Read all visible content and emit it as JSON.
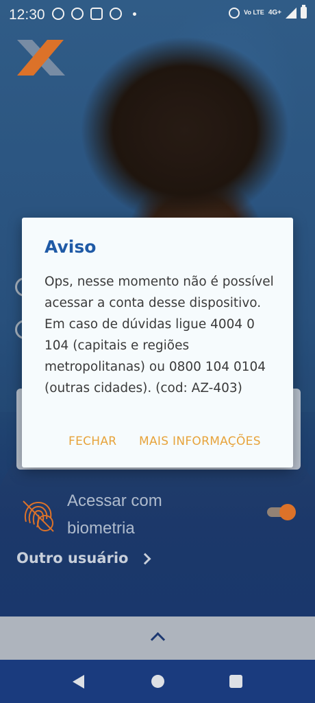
{
  "status_bar": {
    "time": "12:30",
    "network": "4G+",
    "volte": "Vo LTE",
    "icons_left": [
      "chat-bubble-icon",
      "whatsapp-icon",
      "instagram-icon",
      "avatar-icon"
    ],
    "icons_right": [
      "alarm-icon",
      "volte-icon",
      "signal-icon",
      "battery-icon"
    ]
  },
  "dialog": {
    "title": "Aviso",
    "message": "Ops, nesse momento não é possível acessar a conta desse dispositivo. Em caso de dúvidas ligue 4004 0 104 (capitais e regiões metropolitanas) ou 0800 104 0104 (outras cidades). (cod: AZ-403)",
    "close_label": "FECHAR",
    "more_info_label": "MAIS INFORMAÇÕES"
  },
  "login": {
    "biometry_label": "Acessar com biometria",
    "biometry_enabled": true,
    "other_user_label": "Outro usuário"
  },
  "colors": {
    "brand_blue": "#1f5aa6",
    "brand_orange": "#e8792c",
    "action_text": "#e7a33b",
    "navbar": "#1c3f85"
  }
}
